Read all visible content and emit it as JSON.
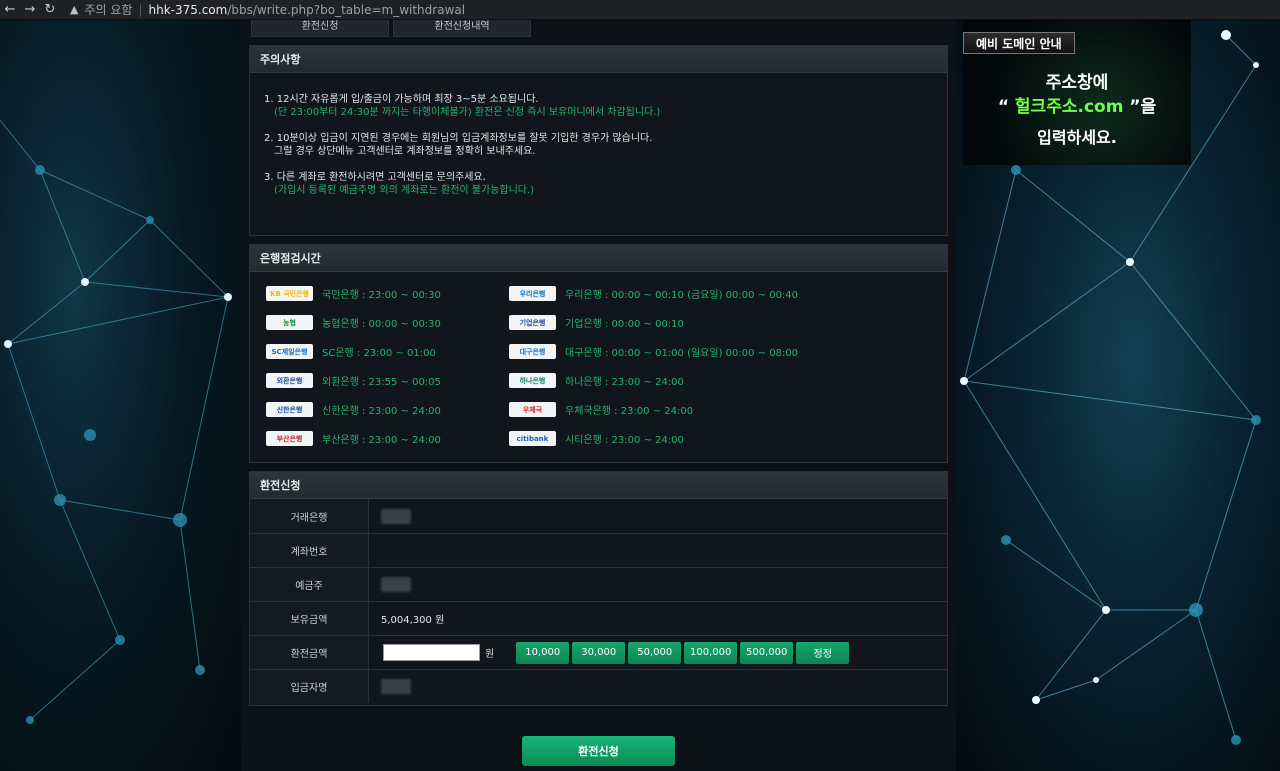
{
  "browser": {
    "security_label": "주의 요함",
    "domain": "hhk-375.com",
    "path": "/bbs/write.php?bo_table=m_withdrawal"
  },
  "tabs": [
    "환전신청",
    "환전신청내역"
  ],
  "notice": {
    "title": "주의사항",
    "items": [
      {
        "line": "1. 12시간 자유롭게 입/출금이 가능하며 최장 3~5분 소요됩니다.",
        "sub": "(단 23:00부터 24:30분 까지는 타행이체불가) 환전은 신청 즉시 보유머니에서 차감됩니다.)",
        "line2": ""
      },
      {
        "line": "2. 10분이상 입금이 지연된 경우에는 회원님의 입금계좌정보를 잘못 기입한 경우가 많습니다.",
        "sub": "",
        "line2": "그럴 경우 상단메뉴 고객센터로 계좌정보를 정확히 보내주세요."
      },
      {
        "line": "3. 다른 계좌로 환전하시려면 고객센터로 문의주세요.",
        "sub": "(가입시 등록된 예금주명 외의 계좌로는 환전이 불가능합니다.)",
        "line2": ""
      }
    ]
  },
  "banks": {
    "title": "은행점검시간",
    "left": [
      {
        "logo": "KB 국민은행",
        "text": "국민은행 : 23:00 ~ 00:30",
        "color": "#f2b705"
      },
      {
        "logo": "농협",
        "text": "농협은행 : 00:00 ~ 00:30",
        "color": "#1e8f3e"
      },
      {
        "logo": "SC제일은행",
        "text": "SC은행 : 23:00 ~ 01:00",
        "color": "#1b6fb8"
      },
      {
        "logo": "외환은행",
        "text": "외환은행 : 23:55 ~ 00:05",
        "color": "#1a4f9a"
      },
      {
        "logo": "신한은행",
        "text": "신한은행 : 23:00 ~ 24:00",
        "color": "#1a4fa0"
      },
      {
        "logo": "부산은행",
        "text": "부산은행 : 23:00 ~ 24:00",
        "color": "#d0202e"
      }
    ],
    "right": [
      {
        "logo": "우리은행",
        "text": "우리은행 : 00:00 ~ 00:10 (금요일) 00:00 ~ 00:40",
        "color": "#0a6fc0"
      },
      {
        "logo": "기업은행",
        "text": "기업은행 : 00:00 ~ 00:10",
        "color": "#1a4a8a"
      },
      {
        "logo": "대구은행",
        "text": "대구은행 : 00:00 ~ 01:00 (일요일) 00:00 ~ 08:00",
        "color": "#1a72c4"
      },
      {
        "logo": "하나은행",
        "text": "하나은행 : 23:00 ~ 24:00",
        "color": "#0f8a6e"
      },
      {
        "logo": "우체국",
        "text": "우체국은행 : 23:00 ~ 24:00",
        "color": "#d42a2a"
      },
      {
        "logo": "citibank",
        "text": "시티은행 : 23:00 ~ 24:00",
        "color": "#1a5fb4"
      }
    ]
  },
  "form": {
    "title": "환전신청",
    "labels": {
      "bank": "거래은행",
      "account": "계좌번호",
      "holder": "예금주",
      "balance": "보유금액",
      "amount": "환전금액",
      "depositor": "입금자명"
    },
    "balance_value": "5,004,300 원",
    "won": "원",
    "amount_buttons": [
      "10,000",
      "30,000",
      "50,000",
      "100,000",
      "500,000",
      "정정"
    ]
  },
  "submit_label": "환전신청",
  "banner": {
    "tag": "예비 도메인 안내",
    "line1": "주소창에",
    "line2_prefix": "“ ",
    "line2_domain": "헐크주소.com",
    "line2_suffix": " ”을",
    "line3": "입력하세요."
  }
}
